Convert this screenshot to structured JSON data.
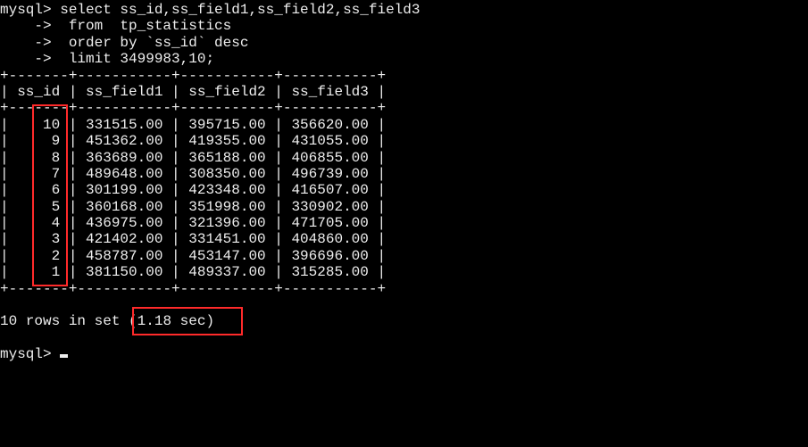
{
  "prompt": "mysql>",
  "continuation": "    ->",
  "query": {
    "line1": " select ss_id,ss_field1,ss_field2,ss_field3",
    "line2": "  from  tp_statistics",
    "line3": "  order by `ss_id` desc",
    "line4": "  limit 3499983,10;"
  },
  "separator": "+-------+-----------+-----------+-----------+",
  "header": "| ss_id | ss_field1 | ss_field2 | ss_field3 |",
  "rows": [
    "|    10 | 331515.00 | 395715.00 | 356620.00 |",
    "|     9 | 451362.00 | 419355.00 | 431055.00 |",
    "|     8 | 363689.00 | 365188.00 | 406855.00 |",
    "|     7 | 489648.00 | 308350.00 | 496739.00 |",
    "|     6 | 301199.00 | 423348.00 | 416507.00 |",
    "|     5 | 360168.00 | 351998.00 | 330902.00 |",
    "|     4 | 436975.00 | 321396.00 | 471705.00 |",
    "|     3 | 421402.00 | 331451.00 | 404860.00 |",
    "|     2 | 458787.00 | 453147.00 | 396696.00 |",
    "|     1 | 381150.00 | 489337.00 | 315285.00 |"
  ],
  "summary_prefix": "10 rows in set ",
  "summary_time": "(1.18 sec)",
  "blank": "",
  "chart_data": {
    "type": "table",
    "columns": [
      "ss_id",
      "ss_field1",
      "ss_field2",
      "ss_field3"
    ],
    "data": [
      [
        10,
        331515.0,
        395715.0,
        356620.0
      ],
      [
        9,
        451362.0,
        419355.0,
        431055.0
      ],
      [
        8,
        363689.0,
        365188.0,
        406855.0
      ],
      [
        7,
        489648.0,
        308350.0,
        496739.0
      ],
      [
        6,
        301199.0,
        423348.0,
        416507.0
      ],
      [
        5,
        360168.0,
        351998.0,
        330902.0
      ],
      [
        4,
        436975.0,
        321396.0,
        471705.0
      ],
      [
        3,
        421402.0,
        331451.0,
        404860.0
      ],
      [
        2,
        458787.0,
        453147.0,
        396696.0
      ],
      [
        1,
        381150.0,
        489337.0,
        315285.0
      ]
    ],
    "query": "select ss_id,ss_field1,ss_field2,ss_field3 from tp_statistics order by `ss_id` desc limit 3499983,10;",
    "rows_in_set": 10,
    "elapsed_sec": 1.18
  }
}
